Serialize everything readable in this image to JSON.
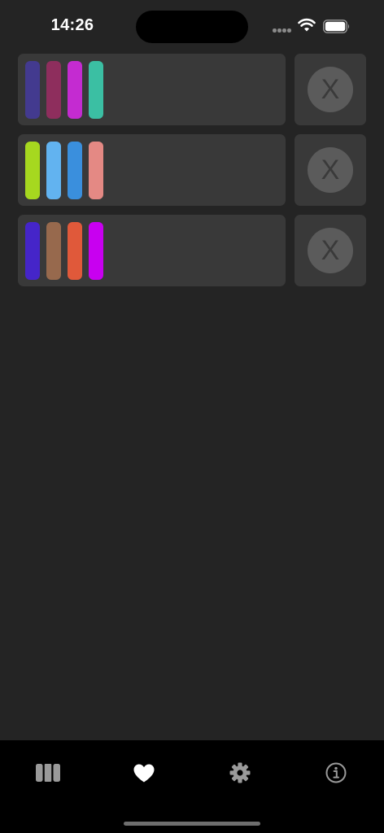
{
  "status_bar": {
    "time": "14:26"
  },
  "palettes": [
    {
      "swatches": [
        "#433a8f",
        "#8e2e5d",
        "#c42bd1",
        "#3bbfa3"
      ],
      "delete_label": "X"
    },
    {
      "swatches": [
        "#a6d81f",
        "#62b3f0",
        "#3a8fdd",
        "#e48984"
      ],
      "delete_label": "X"
    },
    {
      "swatches": [
        "#4525c9",
        "#97694d",
        "#e0593a",
        "#c800f0"
      ],
      "delete_label": "X"
    }
  ],
  "tab_bar": {
    "tabs": [
      {
        "icon": "palette-columns-icon",
        "selected": false
      },
      {
        "icon": "heart-icon",
        "selected": true
      },
      {
        "icon": "gear-icon",
        "selected": false
      },
      {
        "icon": "info-icon",
        "selected": false
      }
    ],
    "active_color": "#ffffff",
    "inactive_color": "#9a9a9a"
  }
}
